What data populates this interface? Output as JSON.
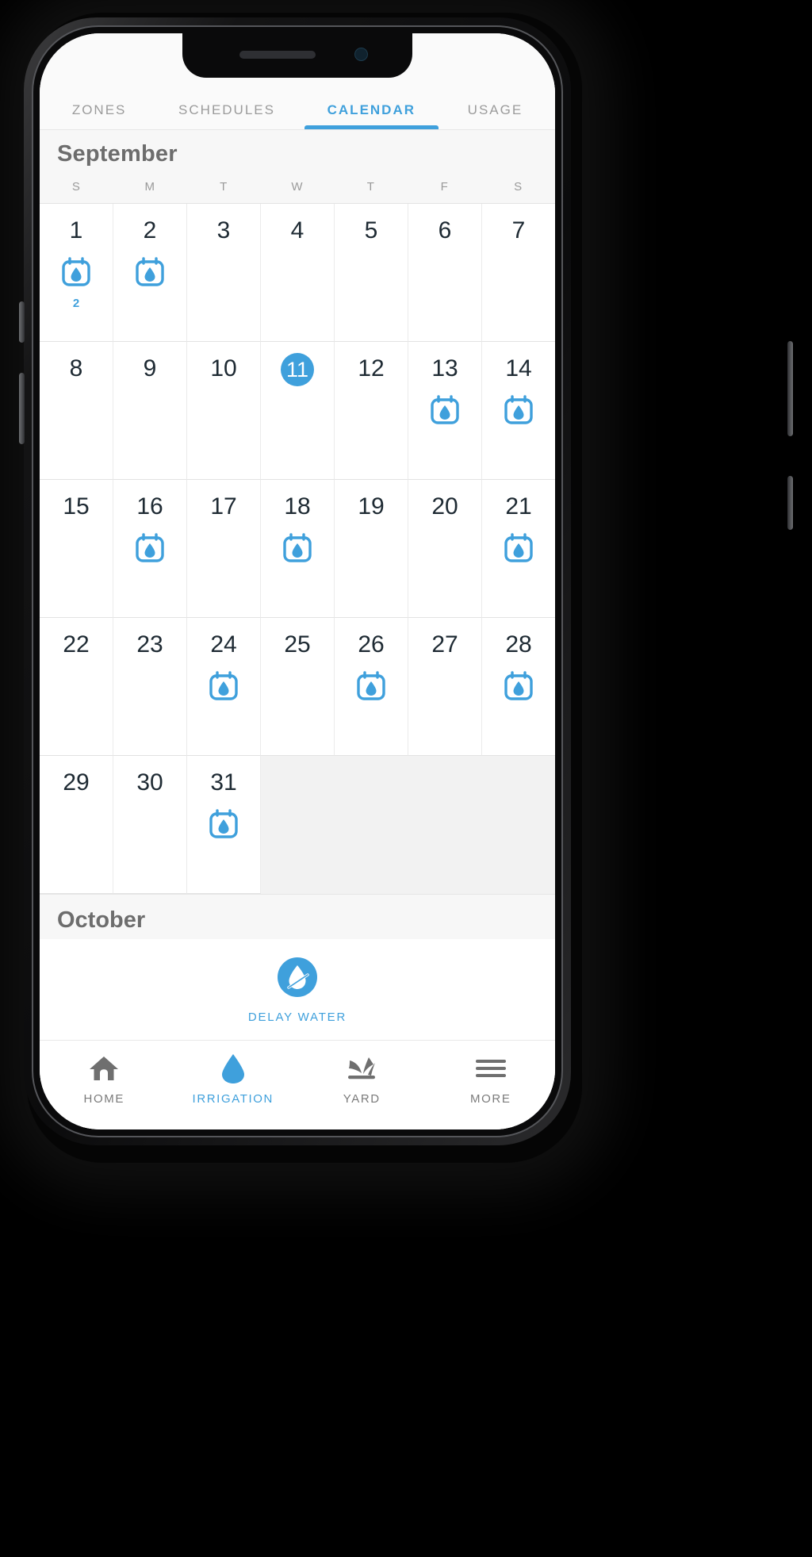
{
  "app": {
    "accent_color": "#3FA0DC",
    "text_color": "#1e2a33",
    "muted_color": "#9b9b9b"
  },
  "tabs": [
    {
      "label": "ZONES",
      "active": false
    },
    {
      "label": "SCHEDULES",
      "active": false
    },
    {
      "label": "CALENDAR",
      "active": true
    },
    {
      "label": "USAGE",
      "active": false
    }
  ],
  "calendar": {
    "month_title": "September",
    "next_month_title": "October",
    "weekdays": [
      "S",
      "M",
      "T",
      "W",
      "T",
      "F",
      "S"
    ],
    "selected_day": "11",
    "weeks": [
      [
        {
          "day": "1",
          "event": true,
          "count": "2",
          "selected": false
        },
        {
          "day": "2",
          "event": true,
          "count": "",
          "selected": false
        },
        {
          "day": "3",
          "event": false,
          "count": "",
          "selected": false
        },
        {
          "day": "4",
          "event": false,
          "count": "",
          "selected": false
        },
        {
          "day": "5",
          "event": false,
          "count": "",
          "selected": false
        },
        {
          "day": "6",
          "event": false,
          "count": "",
          "selected": false
        },
        {
          "day": "7",
          "event": false,
          "count": "",
          "selected": false
        }
      ],
      [
        {
          "day": "8",
          "event": false,
          "count": "",
          "selected": false
        },
        {
          "day": "9",
          "event": false,
          "count": "",
          "selected": false
        },
        {
          "day": "10",
          "event": false,
          "count": "",
          "selected": false
        },
        {
          "day": "11",
          "event": false,
          "count": "",
          "selected": true
        },
        {
          "day": "12",
          "event": false,
          "count": "",
          "selected": false
        },
        {
          "day": "13",
          "event": true,
          "count": "",
          "selected": false
        },
        {
          "day": "14",
          "event": true,
          "count": "",
          "selected": false
        }
      ],
      [
        {
          "day": "15",
          "event": false,
          "count": "",
          "selected": false
        },
        {
          "day": "16",
          "event": true,
          "count": "",
          "selected": false
        },
        {
          "day": "17",
          "event": false,
          "count": "",
          "selected": false
        },
        {
          "day": "18",
          "event": true,
          "count": "",
          "selected": false
        },
        {
          "day": "19",
          "event": false,
          "count": "",
          "selected": false
        },
        {
          "day": "20",
          "event": false,
          "count": "",
          "selected": false
        },
        {
          "day": "21",
          "event": true,
          "count": "",
          "selected": false
        }
      ],
      [
        {
          "day": "22",
          "event": false,
          "count": "",
          "selected": false
        },
        {
          "day": "23",
          "event": false,
          "count": "",
          "selected": false
        },
        {
          "day": "24",
          "event": true,
          "count": "",
          "selected": false
        },
        {
          "day": "25",
          "event": false,
          "count": "",
          "selected": false
        },
        {
          "day": "26",
          "event": true,
          "count": "",
          "selected": false
        },
        {
          "day": "27",
          "event": false,
          "count": "",
          "selected": false
        },
        {
          "day": "28",
          "event": true,
          "count": "",
          "selected": false
        }
      ],
      [
        {
          "day": "29",
          "event": false,
          "count": "",
          "selected": false
        },
        {
          "day": "30",
          "event": false,
          "count": "",
          "selected": false
        },
        {
          "day": "31",
          "event": true,
          "count": "",
          "selected": false
        },
        {
          "day": "",
          "event": false,
          "count": "",
          "selected": false
        },
        {
          "day": "",
          "event": false,
          "count": "",
          "selected": false
        },
        {
          "day": "",
          "event": false,
          "count": "",
          "selected": false
        },
        {
          "day": "",
          "event": false,
          "count": "",
          "selected": false
        }
      ]
    ]
  },
  "delay_water": {
    "label": "DELAY WATER",
    "icon": "water-delay-icon"
  },
  "bottom_nav": [
    {
      "label": "HOME",
      "icon": "home-icon",
      "active": false
    },
    {
      "label": "IRRIGATION",
      "icon": "water-drop-icon",
      "active": true
    },
    {
      "label": "YARD",
      "icon": "grass-sprout-icon",
      "active": false
    },
    {
      "label": "MORE",
      "icon": "hamburger-menu-icon",
      "active": false
    }
  ]
}
